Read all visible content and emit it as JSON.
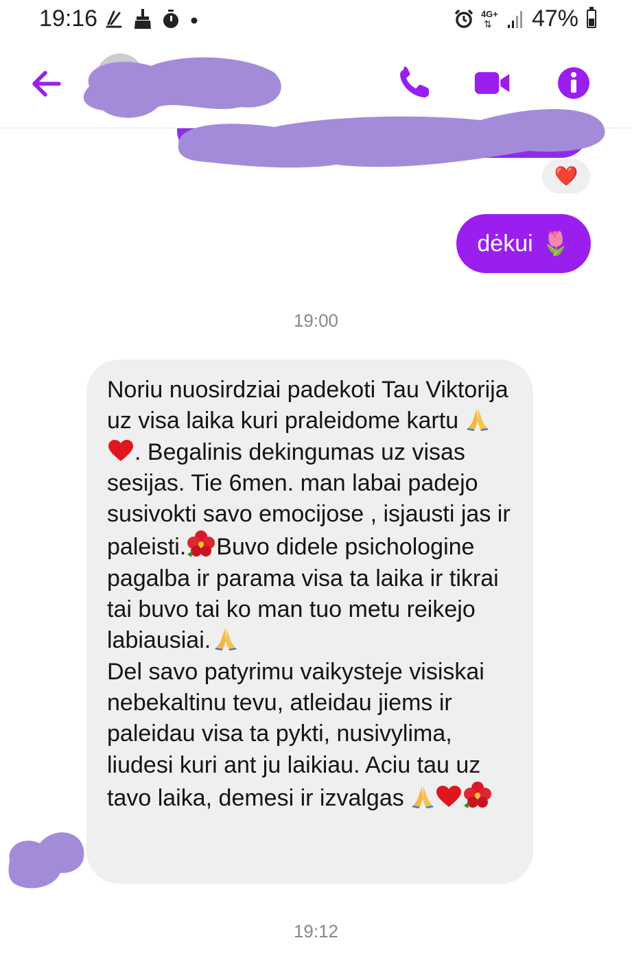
{
  "status_bar": {
    "time": "19:16",
    "network": "4G+",
    "battery": "47%",
    "battery_level": 0.47,
    "icons": [
      "wave-icon",
      "broom-icon",
      "timer-icon",
      "dot-icon",
      "alarm-icon",
      "network-icon",
      "signal-icon",
      "battery-icon"
    ]
  },
  "header": {
    "back_icon": "arrow-left-icon",
    "contact_name": "",
    "actions": [
      "phone-icon",
      "video-camera-icon",
      "info-icon"
    ],
    "accent_color": "#9a1fef"
  },
  "messages": {
    "reaction": "❤️",
    "outgoing_text": "dėkui",
    "outgoing_emoji": "🌷",
    "timestamp_1": "19:00",
    "incoming_text_1": "Noriu nuosirdziai padekoti Tau Viktorija uz visa laika kuri praleidome kartu ",
    "incoming_text_2": ". Begalinis dekingumas uz visas sesijas. Tie 6men. man labai padejo susivokti savo emocijose , isjausti jas ir paleisti.",
    "incoming_text_3": "Buvo didele psichologine pagalba ir parama visa ta laika ir tikrai tai buvo tai ko man tuo metu reikejo labiausiai.",
    "incoming_text_4": "Del savo patyrimu vaikysteje visiskai nebekaltinu tevu, atleidau jiems ir paleidau visa ta pykti, nusivylima, liudesi kuri ant ju laikiau. Aciu tau uz tavo laika, demesi ir izvalgas ",
    "timestamp_2": "19:12"
  }
}
